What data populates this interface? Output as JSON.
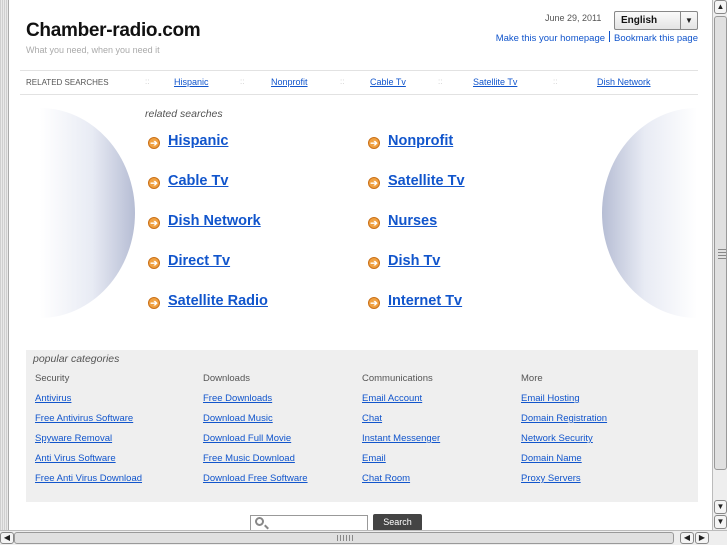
{
  "header": {
    "site_title": "Chamber-radio.com",
    "tagline": "What you need, when you need it",
    "date": "June 29, 2011",
    "language": "English",
    "homepage_link": "Make this your homepage",
    "bookmark_link": "Bookmark this page"
  },
  "related_bar": {
    "label": "RELATED SEARCHES",
    "separator": "::",
    "items": [
      "Hispanic",
      "Nonprofit",
      "Cable Tv",
      "Satellite Tv",
      "Dish Network"
    ]
  },
  "related_searches": {
    "title": "related searches",
    "arrow_glyph": "➔",
    "left": [
      "Hispanic",
      "Cable Tv",
      "Dish Network",
      "Direct Tv",
      "Satellite Radio"
    ],
    "right": [
      "Nonprofit",
      "Satellite Tv",
      "Nurses",
      "Dish Tv",
      "Internet Tv"
    ]
  },
  "popular": {
    "title": "popular categories",
    "columns": [
      {
        "heading": "Security",
        "links": [
          "Antivirus",
          "Free Antivirus Software",
          "Spyware Removal",
          "Anti Virus Software",
          "Free Anti Virus Download"
        ]
      },
      {
        "heading": "Downloads",
        "links": [
          "Free Downloads",
          "Download Music",
          "Download Full Movie",
          "Free Music Download",
          "Download Free Software"
        ]
      },
      {
        "heading": "Communications",
        "links": [
          "Email Account",
          "Chat",
          "Instant Messenger",
          "Email",
          "Chat Room"
        ]
      },
      {
        "heading": "More",
        "links": [
          "Email Hosting",
          "Domain Registration",
          "Network Security",
          "Domain Name",
          "Proxy Servers"
        ]
      }
    ]
  },
  "search": {
    "button_label": "Search",
    "value": ""
  },
  "scrollbars": {
    "up": "▲",
    "down": "▼",
    "left": "◀",
    "right": "▶"
  },
  "colors": {
    "link": "#1155cc",
    "bullet": "#f0a040",
    "category_bg": "#efefef"
  }
}
